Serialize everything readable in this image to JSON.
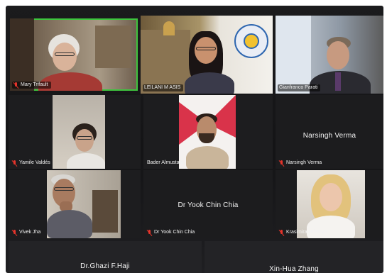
{
  "participants": {
    "mary": {
      "name": "Mary Trifault",
      "muted": true
    },
    "leilani": {
      "name": "LEILANI M ASIS",
      "muted": false
    },
    "gianfranco": {
      "name": "Gianfranco Parati",
      "muted": false
    },
    "yamile": {
      "name": "Yamile Valdés",
      "muted": true
    },
    "bader": {
      "name": "Bader Almustafa",
      "muted": false
    },
    "narsingh": {
      "name": "Narsingh Verma",
      "display_name": "Narsingh Verma",
      "muted": true
    },
    "vivek": {
      "name": "Vivek Jha",
      "muted": true
    },
    "yook": {
      "name": "Dr Yook Chin Chia",
      "display_name": "Dr  Yook Chin Chia",
      "muted": true
    },
    "krasimira": {
      "name": "Krasimira Hristova",
      "muted": true
    },
    "ghazi": {
      "display_name": "Dr.Ghazi F.Haji"
    },
    "xinhua": {
      "display_name": "Xin-Hua Zhang"
    }
  },
  "colors": {
    "active_speaker_border": "#3ec43e",
    "muted_icon": "#e5342b",
    "tile_background": "#1c1c1e"
  }
}
